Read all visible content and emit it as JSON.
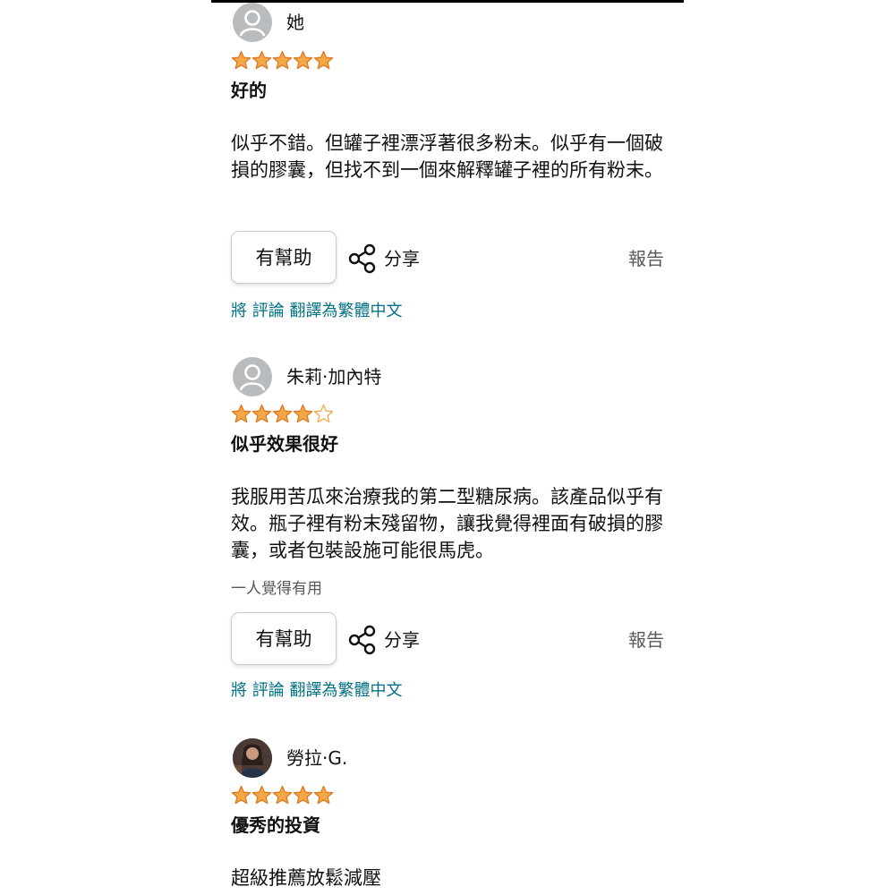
{
  "colors": {
    "star": "#f3a847",
    "link": "#007185",
    "muted": "#565959"
  },
  "icons": {
    "avatar_default": "person-silhouette-icon",
    "star": "star-icon",
    "share": "share-icon"
  },
  "reviews": [
    {
      "reviewer": "她",
      "rating": 5,
      "title": "好的",
      "body": "似乎不錯。但罐子裡漂浮著很多粉末。似乎有一個破損的膠囊，但找不到一個來解釋罐子裡的所有粉末。",
      "helpful_count_text": "",
      "helpful_label": "有幫助",
      "share_label": "分享",
      "report_label": "報告",
      "translate_text": "將 評論 翻譯為繁體中文"
    },
    {
      "reviewer": "朱莉·加內特",
      "rating": 4,
      "title": "似乎效果很好",
      "body": "我服用苦瓜來治療我的第二型糖尿病。該產品似乎有效。瓶子裡有粉末殘留物，讓我覺得裡面有破損的膠囊，或者包裝設施可能很馬虎。",
      "helpful_count_text": "一人覺得有用",
      "helpful_label": "有幫助",
      "share_label": "分享",
      "report_label": "報告",
      "translate_text": "將 評論 翻譯為繁體中文"
    },
    {
      "reviewer": "勞拉·G.",
      "rating": 5,
      "title": "優秀的投資",
      "body": "超級推薦放鬆減壓"
    }
  ]
}
